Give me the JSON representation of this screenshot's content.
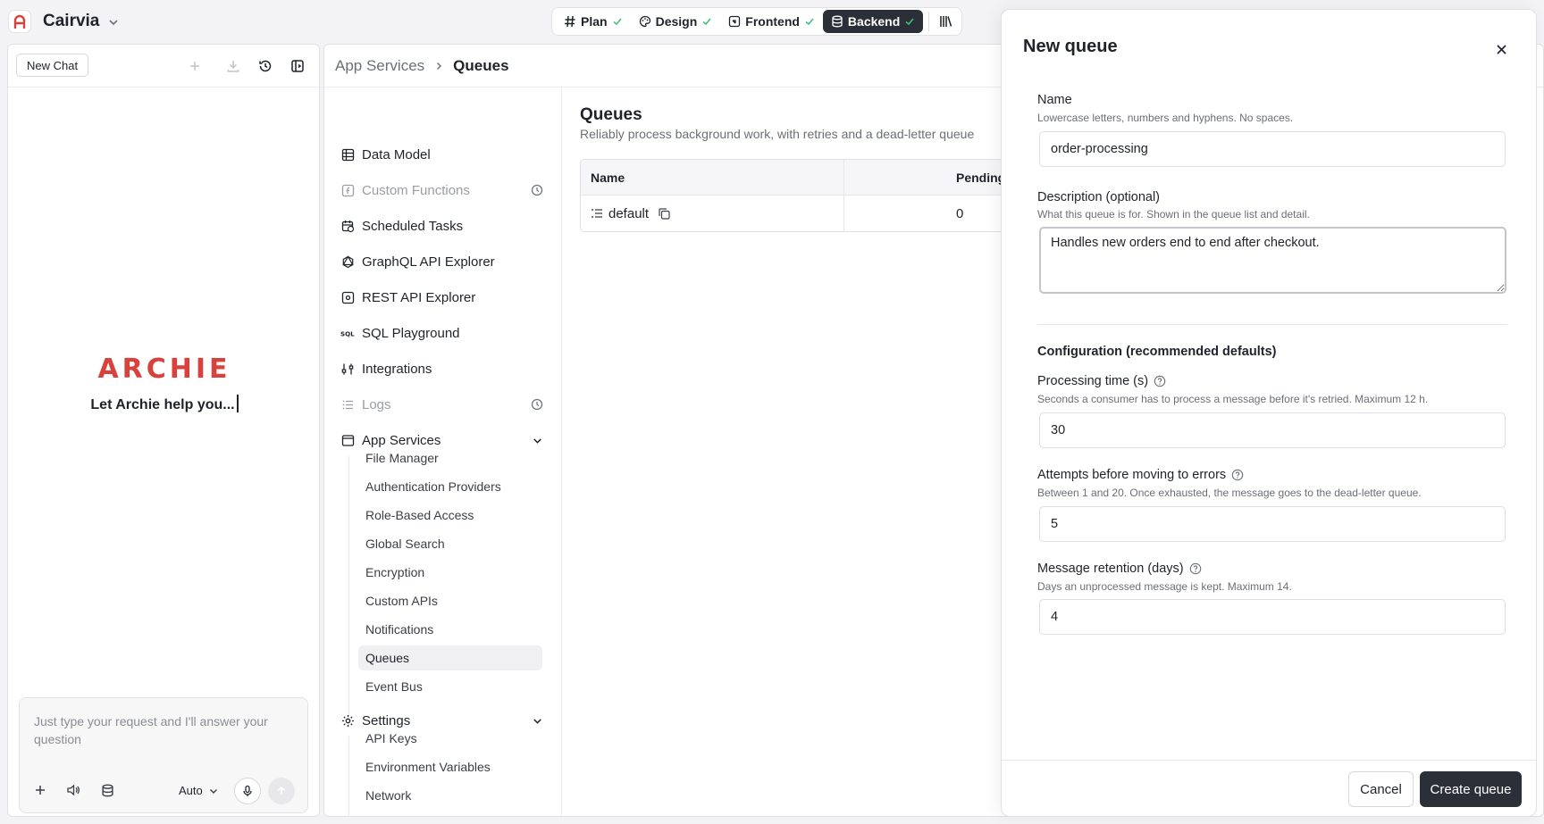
{
  "app": {
    "name": "Cairvia"
  },
  "steps": [
    {
      "label": "Plan"
    },
    {
      "label": "Design"
    },
    {
      "label": "Frontend"
    },
    {
      "label": "Backend"
    }
  ],
  "chat": {
    "new_chat_label": "New Chat",
    "logo_text": "ARCHIE",
    "tagline": "Let Archie help you...",
    "input_placeholder": "Just type your request and I'll answer your question",
    "mode": "Auto"
  },
  "breadcrumb": {
    "root": "App Services",
    "current": "Queues"
  },
  "nav": {
    "items": [
      {
        "label": "Data Model"
      },
      {
        "label": "Custom Functions"
      },
      {
        "label": "Scheduled Tasks"
      },
      {
        "label": "GraphQL API Explorer"
      },
      {
        "label": "REST API Explorer"
      },
      {
        "label": "SQL Playground"
      },
      {
        "label": "Integrations"
      },
      {
        "label": "Logs"
      },
      {
        "label": "App Services"
      },
      {
        "label": "Settings"
      }
    ],
    "app_services_sub": [
      {
        "label": "File Manager"
      },
      {
        "label": "Authentication Providers"
      },
      {
        "label": "Role-Based Access"
      },
      {
        "label": "Global Search"
      },
      {
        "label": "Encryption"
      },
      {
        "label": "Custom APIs"
      },
      {
        "label": "Notifications"
      },
      {
        "label": "Queues"
      },
      {
        "label": "Event Bus"
      }
    ],
    "settings_sub": [
      {
        "label": "API Keys"
      },
      {
        "label": "Environment Variables"
      },
      {
        "label": "Network"
      }
    ]
  },
  "queues": {
    "title": "Queues",
    "subtitle": "Reliably process background work, with retries and a dead-letter queue",
    "columns": [
      "Name",
      "Pending"
    ],
    "rows": [
      {
        "name": "default",
        "pending": "0"
      }
    ]
  },
  "drawer": {
    "title": "New queue",
    "name_label": "Name",
    "name_help": "Lowercase letters, numbers and hyphens. No spaces.",
    "name_value": "order-processing",
    "desc_label": "Description (optional)",
    "desc_help": "What this queue is for. Shown in the queue list and detail.",
    "desc_value": "Handles new orders end to end after checkout.",
    "config_heading": "Configuration (recommended defaults)",
    "processing_label": "Processing time (s)",
    "processing_help": "Seconds a consumer has to process a message before it's retried. Maximum 12 h.",
    "processing_value": "30",
    "attempts_label": "Attempts before moving to errors",
    "attempts_help": "Between 1 and 20. Once exhausted, the message goes to the dead-letter queue.",
    "attempts_value": "5",
    "retention_label": "Message retention (days)",
    "retention_help": "Days an unprocessed message is kept. Maximum 14.",
    "retention_value": "4",
    "cancel_label": "Cancel",
    "create_label": "Create queue"
  },
  "colors": {
    "brand": "#d9423c",
    "primary_button": "#2a2f38",
    "success_check": "#3fbf7f"
  }
}
